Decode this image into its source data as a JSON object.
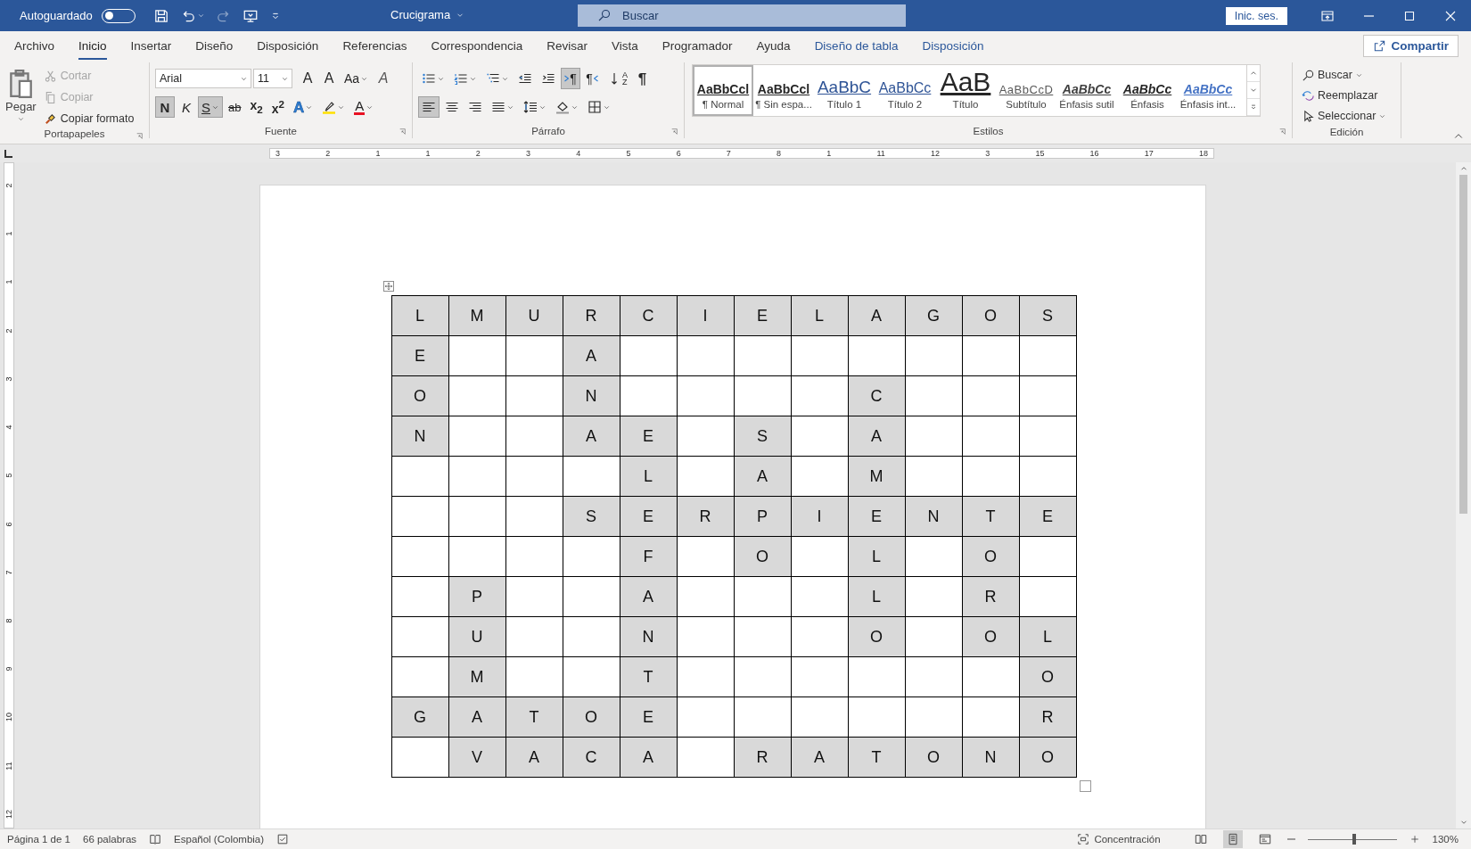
{
  "title_bar": {
    "autosave": {
      "label": "Autoguardado",
      "on": false
    },
    "document_title": "Crucigrama",
    "search": {
      "placeholder": "Buscar"
    },
    "sign_in": "Inic. ses."
  },
  "ribbon_tabs": [
    {
      "label": "Archivo",
      "selected": false,
      "kind": "main"
    },
    {
      "label": "Inicio",
      "selected": true,
      "kind": "main"
    },
    {
      "label": "Insertar",
      "selected": false,
      "kind": "main"
    },
    {
      "label": "Diseño",
      "selected": false,
      "kind": "main"
    },
    {
      "label": "Disposición",
      "selected": false,
      "kind": "main"
    },
    {
      "label": "Referencias",
      "selected": false,
      "kind": "main"
    },
    {
      "label": "Correspondencia",
      "selected": false,
      "kind": "main"
    },
    {
      "label": "Revisar",
      "selected": false,
      "kind": "main"
    },
    {
      "label": "Vista",
      "selected": false,
      "kind": "main"
    },
    {
      "label": "Programador",
      "selected": false,
      "kind": "main"
    },
    {
      "label": "Ayuda",
      "selected": false,
      "kind": "main"
    },
    {
      "label": "Diseño de tabla",
      "selected": false,
      "kind": "contextual"
    },
    {
      "label": "Disposición",
      "selected": false,
      "kind": "contextual"
    }
  ],
  "share": "Compartir",
  "clipboard": {
    "title": "Portapapeles",
    "paste": "Pegar",
    "actions": [
      {
        "kind": "cut",
        "label": "Cortar",
        "disabled": true
      },
      {
        "kind": "copy",
        "label": "Copiar",
        "disabled": true
      },
      {
        "kind": "painter",
        "label": "Copiar formato",
        "disabled": false
      }
    ]
  },
  "font": {
    "title": "Fuente",
    "family": "Arial",
    "size": "11",
    "row1": [
      {
        "kind": "grow",
        "label": "A",
        "selected": false
      },
      {
        "kind": "shrink",
        "label": "A",
        "selected": false
      },
      {
        "kind": "case",
        "label": "Aa",
        "selected": false
      },
      {
        "kind": "clear",
        "label": "A",
        "selected": false
      }
    ],
    "row2": [
      {
        "kind": "bold",
        "label": "N",
        "selected": true
      },
      {
        "kind": "italic",
        "label": "K",
        "selected": false
      },
      {
        "kind": "underline",
        "label": "S",
        "selected": true
      },
      {
        "kind": "strike",
        "label": "ab",
        "selected": false
      },
      {
        "kind": "sub",
        "label": "x$_{2}$",
        "selected": false
      },
      {
        "kind": "sup",
        "label": "x$^{2}$",
        "selected": false
      },
      {
        "kind": "effects",
        "label": "A",
        "selected": false
      },
      {
        "kind": "highlight",
        "selected": false
      },
      {
        "kind": "color",
        "label": "A",
        "selected": false
      }
    ]
  },
  "paragraph": {
    "title": "Párrafo",
    "row1": [
      {
        "kind": "bullets",
        "selected": false
      },
      {
        "kind": "numbering",
        "selected": false
      },
      {
        "kind": "multilevel",
        "selected": false
      },
      {
        "kind": "outdent",
        "selected": false
      },
      {
        "kind": "indent",
        "selected": false
      },
      {
        "kind": "ltr",
        "label": "¶",
        "selected": true
      },
      {
        "kind": "rtl",
        "label": "¶",
        "selected": false
      },
      {
        "kind": "sort",
        "label": "AZ",
        "selected": false
      },
      {
        "kind": "marks",
        "label": "¶",
        "selected": false
      }
    ],
    "row2": [
      {
        "kind": "left",
        "selected": true
      },
      {
        "kind": "center",
        "selected": false
      },
      {
        "kind": "right",
        "selected": false
      },
      {
        "kind": "justify",
        "selected": false
      },
      {
        "kind": "spacing",
        "selected": false
      },
      {
        "kind": "shading",
        "selected": false
      },
      {
        "kind": "borders",
        "selected": false
      }
    ]
  },
  "styles": {
    "title": "Estilos",
    "items": [
      {
        "kind": "normal",
        "sample": "AaBbCcl",
        "name": "¶ Normal",
        "selected": true
      },
      {
        "kind": "nospacing",
        "sample": "AaBbCcl",
        "name": "¶ Sin espa...",
        "selected": false
      },
      {
        "kind": "heading1",
        "sample": "AaBbC",
        "name": "Título 1",
        "selected": false
      },
      {
        "kind": "heading2",
        "sample": "AaBbCc",
        "name": "Título 2",
        "selected": false
      },
      {
        "kind": "title",
        "sample": "AaB",
        "name": "Título",
        "selected": false
      },
      {
        "kind": "subtitle",
        "sample": "AaBbCcD",
        "name": "Subtítulo",
        "selected": false
      },
      {
        "kind": "subtle",
        "sample": "AaBbCc",
        "name": "Énfasis sutil",
        "selected": false
      },
      {
        "kind": "emphasis",
        "sample": "AaBbCc",
        "name": "Énfasis",
        "selected": false
      },
      {
        "kind": "intense",
        "sample": "AaBbCc",
        "name": "Énfasis int...",
        "selected": false
      }
    ]
  },
  "editing": {
    "title": "Edición",
    "items": [
      {
        "kind": "find",
        "label": "Buscar"
      },
      {
        "kind": "replace",
        "label": "Reemplazar"
      },
      {
        "kind": "select",
        "label": "Seleccionar"
      }
    ]
  },
  "ruler": {
    "horizontal": [
      "3",
      "2",
      "1",
      "1",
      "2",
      "3",
      "4",
      "5",
      "6",
      "7",
      "8",
      "1",
      "11",
      "12",
      "3",
      "15",
      "16",
      "17",
      "18"
    ],
    "vertical": [
      "2",
      "1",
      "1",
      "2",
      "3",
      "4",
      "5",
      "6",
      "7",
      "8",
      "9",
      "10",
      "11",
      "12"
    ]
  },
  "crossword": {
    "rows": [
      [
        "L",
        "M",
        "U",
        "R",
        "C",
        "I",
        "E",
        "L",
        "A",
        "G",
        "O",
        "S"
      ],
      [
        "E",
        null,
        null,
        "A",
        null,
        null,
        null,
        null,
        null,
        null,
        null,
        null
      ],
      [
        "O",
        null,
        null,
        "N",
        null,
        null,
        null,
        null,
        "C",
        null,
        null,
        null
      ],
      [
        "N",
        null,
        null,
        "A",
        "E",
        null,
        "S",
        null,
        "A",
        null,
        null,
        null
      ],
      [
        null,
        null,
        null,
        null,
        "L",
        null,
        "A",
        null,
        "M",
        null,
        null,
        null
      ],
      [
        null,
        null,
        null,
        "S",
        "E",
        "R",
        "P",
        "I",
        "E",
        "N",
        "T",
        "E"
      ],
      [
        null,
        null,
        null,
        null,
        "F",
        null,
        "O",
        null,
        "L",
        null,
        "O",
        null
      ],
      [
        null,
        "P",
        null,
        null,
        "A",
        null,
        null,
        null,
        "L",
        null,
        "R",
        null
      ],
      [
        null,
        "U",
        null,
        null,
        "N",
        null,
        null,
        null,
        "O",
        null,
        "O",
        "L"
      ],
      [
        null,
        "M",
        null,
        null,
        "T",
        null,
        null,
        null,
        null,
        null,
        null,
        "O"
      ],
      [
        "G",
        "A",
        "T",
        "O",
        "E",
        null,
        null,
        null,
        null,
        null,
        null,
        "R"
      ],
      [
        null,
        "V",
        "A",
        "C",
        "A",
        null,
        "R",
        "A",
        "T",
        "O",
        "N",
        "O"
      ]
    ]
  },
  "status_bar": {
    "page": "Página 1 de 1",
    "words": "66 palabras",
    "language": "Español (Colombia)",
    "focus": "Concentración",
    "views": [
      {
        "kind": "read",
        "selected": false
      },
      {
        "kind": "print",
        "selected": true
      },
      {
        "kind": "web",
        "selected": false
      }
    ],
    "zoom": {
      "level": 0.52,
      "label": "130%"
    }
  }
}
